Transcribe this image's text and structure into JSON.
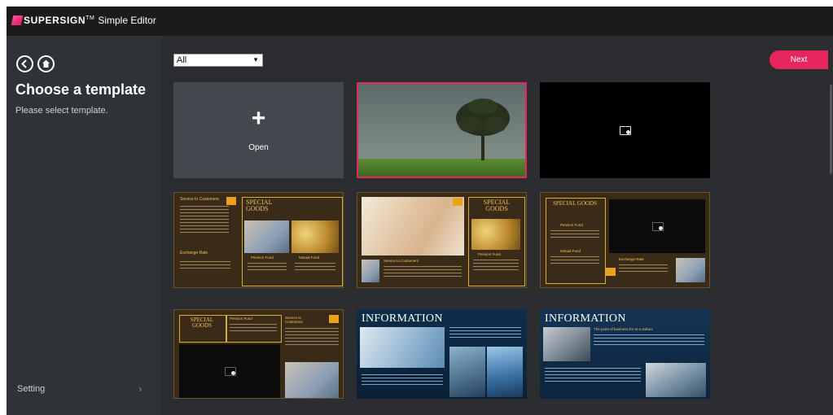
{
  "app": {
    "brand": "SUPERSIGN",
    "brand_tm": "TM",
    "subtitle": "Simple Editor"
  },
  "sidebar": {
    "title": "Choose a template",
    "subtitle": "Please select template.",
    "setting_label": "Setting",
    "setting_chevron": "›",
    "icons": [
      "back-arrow-icon",
      "home-icon"
    ]
  },
  "toolbar": {
    "filter_value": "All",
    "filter_arrow": "▼",
    "next_label": "Next"
  },
  "open_tile": {
    "plus": "+",
    "label": "Open"
  },
  "colors": {
    "accent": "#e8265e",
    "gold": "#d7aa3a",
    "orange": "#e8a21d",
    "sidebar_bg": "#2f3237",
    "titlebar_bg": "#1b1b1b"
  },
  "templates": {
    "t4": {
      "service_title": "Service to Customers",
      "goods_title": "SPECIAL GOODS",
      "exchange_title": "Exchange Rate",
      "pension_title": "Pension Fund",
      "mutual_title": "Mutual Fund"
    },
    "t5": {
      "goods_title": "SPECIAL GOODS",
      "pension_title": "Pension Fund",
      "service_title": "Service to Customers"
    },
    "t6": {
      "goods_title": "SPECIAL GOODS",
      "pension_title": "Pension Fund",
      "mutual_title": "Mutual Fund",
      "exchange_title": "Exchange Rate"
    },
    "t7": {
      "goods_title": "SPECIAL GOODS",
      "pension_title": "Pension Fund",
      "service_title": "Service to Customers"
    },
    "t8": {
      "heading": "INFORMATION"
    },
    "t9": {
      "heading": "INFORMATION",
      "subheading": "The point of business for to a Joburs"
    }
  }
}
